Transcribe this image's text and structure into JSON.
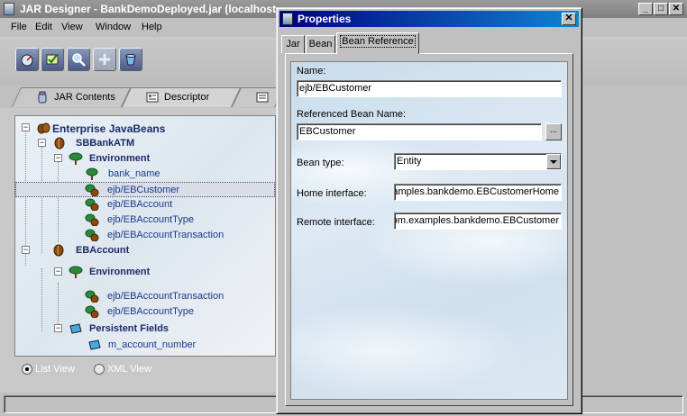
{
  "main_window": {
    "title": "JAR Designer - BankDemoDeployed.jar  (localhost",
    "minimize": "_",
    "maximize": "□",
    "close": "✕"
  },
  "menu": [
    "File",
    "Edit",
    "View",
    "Window",
    "Help"
  ],
  "toolbar": [
    {
      "icon": "gauge-icon"
    },
    {
      "icon": "check-icon"
    },
    {
      "icon": "magnifier-icon"
    },
    {
      "icon": "plus-icon"
    },
    {
      "icon": "bucket-icon"
    }
  ],
  "main_tabs": [
    {
      "label": "JAR Contents",
      "icon": "jar-icon"
    },
    {
      "label": "Descriptor",
      "icon": "descriptor-icon"
    },
    {
      "label": "",
      "icon": "document-icon"
    }
  ],
  "tree": [
    {
      "label": "Enterprise JavaBeans",
      "level": 0,
      "icon": "beans-icon",
      "bold": true,
      "expander": "−"
    },
    {
      "label": "SBBankATM",
      "level": 1,
      "icon": "bean-icon",
      "bold": true,
      "expander": "−"
    },
    {
      "label": "Environment",
      "level": 2,
      "icon": "tree-icon",
      "bold": true,
      "expander": "−"
    },
    {
      "label": "bank_name",
      "level": 3,
      "icon": "tree-icon",
      "bold": false,
      "expander": ""
    },
    {
      "label": "ejb/EBCustomer",
      "level": 3,
      "icon": "bean-ref-icon",
      "bold": false,
      "expander": "",
      "selected": true
    },
    {
      "label": "ejb/EBAccount",
      "level": 3,
      "icon": "bean-ref-icon",
      "bold": false,
      "expander": ""
    },
    {
      "label": "ejb/EBAccountType",
      "level": 3,
      "icon": "bean-ref-icon",
      "bold": false,
      "expander": ""
    },
    {
      "label": "ejb/EBAccountTransaction",
      "level": 3,
      "icon": "bean-ref-icon",
      "bold": false,
      "expander": ""
    },
    {
      "label": "EBAccount",
      "level": 1,
      "icon": "bean-icon",
      "bold": true,
      "expander": "−"
    },
    {
      "label": "Environment",
      "level": 2,
      "icon": "tree-icon",
      "bold": true,
      "expander": "−"
    },
    {
      "label": "ejb/EBAccountTransaction",
      "level": 3,
      "icon": "bean-ref-icon",
      "bold": false,
      "expander": ""
    },
    {
      "label": "ejb/EBAccountType",
      "level": 3,
      "icon": "bean-ref-icon",
      "bold": false,
      "expander": ""
    },
    {
      "label": "Persistent Fields",
      "level": 2,
      "icon": "field-icon",
      "bold": true,
      "expander": "−"
    },
    {
      "label": "m_account_number",
      "level": 3,
      "icon": "field-icon",
      "bold": false,
      "expander": ""
    }
  ],
  "view_options": {
    "list": {
      "label": "List View",
      "selected": true
    },
    "xml": {
      "label": "XML View",
      "selected": false
    }
  },
  "properties": {
    "title": "Properties",
    "close": "✕",
    "tabs": [
      "Jar",
      "Bean",
      "Bean Reference"
    ],
    "active_tab": "Bean Reference",
    "fields": {
      "name_label": "Name:",
      "name_value": "ejb/EBCustomer",
      "ref_bean_label": "Referenced Bean Name:",
      "ref_bean_value": "EBCustomer",
      "browse": "...",
      "bean_type_label": "Bean type:",
      "bean_type_value": "Entity",
      "home_label": "Home interface:",
      "home_value": "com.examples.bankdemo.EBCustomerHome",
      "remote_label": "Remote interface:",
      "remote_value": "com.examples.bankdemo.EBCustomer"
    }
  },
  "colors": {
    "dialog_title": "#000080",
    "tree_label": "#1a3a8a"
  }
}
